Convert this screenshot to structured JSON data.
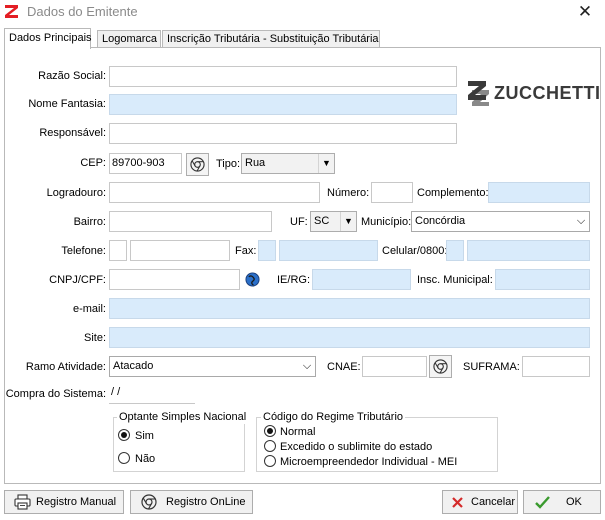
{
  "window": {
    "title": "Dados do Emitente",
    "close_glyph": "✕",
    "app_icon": "zucchetti-red-icon"
  },
  "tabs": [
    {
      "label": "Dados Principais",
      "active": true
    },
    {
      "label": "Logomarca",
      "active": false
    },
    {
      "label": "Inscrição Tributária - Substituição Tributária",
      "active": false
    }
  ],
  "logo": {
    "text": "ZUCCHETTI",
    "color": "#3a3a3a"
  },
  "form": {
    "razao_social": {
      "label": "Razão Social:",
      "value": ""
    },
    "nome_fantasia": {
      "label": "Nome Fantasia:",
      "value": ""
    },
    "responsavel": {
      "label": "Responsável:",
      "value": ""
    },
    "cep": {
      "label": "CEP:",
      "value": "89700-903"
    },
    "tipo": {
      "label": "Tipo:",
      "value": "Rua"
    },
    "logradouro": {
      "label": "Logradouro:",
      "value": ""
    },
    "numero": {
      "label": "Número:",
      "value": ""
    },
    "complemento": {
      "label": "Complemento:",
      "value": ""
    },
    "bairro": {
      "label": "Bairro:",
      "value": ""
    },
    "uf": {
      "label": "UF:",
      "value": "SC"
    },
    "municipio": {
      "label": "Município:",
      "value": "Concórdia"
    },
    "telefone": {
      "label": "Telefone:",
      "value": ""
    },
    "fax": {
      "label": "Fax:",
      "value": ""
    },
    "celular": {
      "label": "Celular/0800:",
      "value": ""
    },
    "cnpj": {
      "label": "CNPJ/CPF:",
      "value": ""
    },
    "ie_rg": {
      "label": "IE/RG:",
      "value": ""
    },
    "insc_municipal": {
      "label": "Insc. Municipal:",
      "value": ""
    },
    "email": {
      "label": "e-mail:",
      "value": ""
    },
    "site": {
      "label": "Site:",
      "value": ""
    },
    "ramo_atividade": {
      "label": "Ramo Atividade:",
      "value": "Atacado"
    },
    "cnae": {
      "label": "CNAE:",
      "value": ""
    },
    "suframa": {
      "label": "SUFRAMA:",
      "value": ""
    },
    "compra_sistema": {
      "label": "Compra do Sistema:",
      "value": " / /"
    }
  },
  "simples_nacional": {
    "title": "Optante Simples Nacional",
    "options": [
      {
        "label": "Sim",
        "checked": true
      },
      {
        "label": "Não",
        "checked": false
      }
    ]
  },
  "regime_tributario": {
    "title": "Código do Regime Tributário",
    "options": [
      {
        "label": "Normal",
        "checked": true
      },
      {
        "label": "Excedido o sublimite do estado",
        "checked": false
      },
      {
        "label": "Microempreendedor Individual - MEI",
        "checked": false
      }
    ]
  },
  "buttons": {
    "registro_manual": "Registro Manual",
    "registro_online": "Registro OnLine",
    "cancelar": "Cancelar",
    "ok": "OK"
  },
  "colors": {
    "field_blue": "#d9ebfb",
    "cancel_red": "#d42a2a",
    "ok_green": "#3a9a2e",
    "brand_red": "#e31e24"
  }
}
